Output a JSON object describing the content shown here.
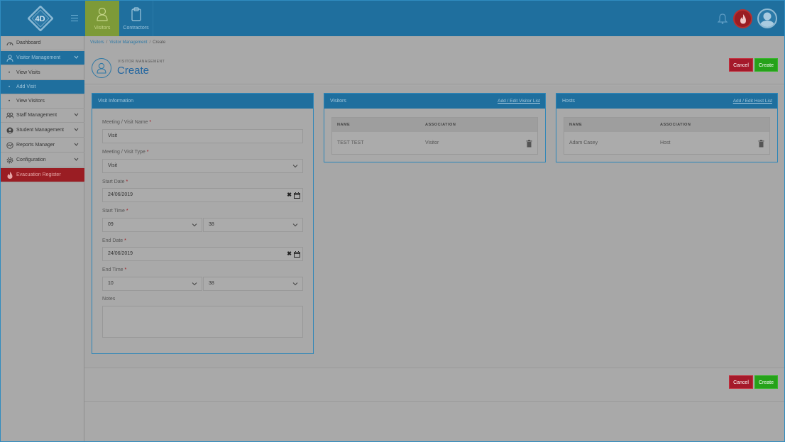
{
  "topbar": {
    "tabs": [
      {
        "label": "Visitors",
        "icon": "person-icon",
        "active": true
      },
      {
        "label": "Contractors",
        "icon": "clipboard-icon",
        "active": false
      }
    ]
  },
  "sidebar": {
    "items": [
      {
        "label": "Dashboard",
        "icon": "dashboard-icon"
      },
      {
        "label": "Visitor Management",
        "icon": "person-icon",
        "active": true
      },
      {
        "label": "View Visits"
      },
      {
        "label": "Add Visit",
        "active": true
      },
      {
        "label": "View Visitors"
      },
      {
        "label": "Staff Management",
        "icon": "staff-icon"
      },
      {
        "label": "Student Management",
        "icon": "student-icon"
      },
      {
        "label": "Reports Manager",
        "icon": "reports-icon"
      },
      {
        "label": "Configuration",
        "icon": "gear-icon"
      },
      {
        "label": "Evacuation Register",
        "icon": "flame-icon"
      }
    ]
  },
  "breadcrumb": [
    "Visitors",
    "Visitor Management",
    "Create"
  ],
  "page": {
    "kicker": "VISITOR MANAGEMENT",
    "title": "Create",
    "cancel_label": "Cancel",
    "create_label": "Create"
  },
  "visit_info": {
    "title": "Visit Information",
    "name_label": "Meeting / Visit Name",
    "name_value": "Visit",
    "type_label": "Meeting / Visit Type",
    "type_value": "Visit",
    "start_date_label": "Start Date",
    "start_date_value": "24/06/2019",
    "start_time_label": "Start Time",
    "start_hour": "09",
    "start_minute": "38",
    "end_date_label": "End Date",
    "end_date_value": "24/06/2019",
    "end_time_label": "End Time",
    "end_hour": "10",
    "end_minute": "38",
    "notes_label": "Notes",
    "required_mark": "*"
  },
  "visitors": {
    "title": "Visitors",
    "action": "Add / Edit Visitor List",
    "columns": [
      "NAME",
      "ASSOCIATION"
    ],
    "rows": [
      {
        "name": "TEST TEST",
        "association": "Visitor"
      }
    ]
  },
  "hosts": {
    "title": "Hosts",
    "action": "Add / Edit Host List",
    "columns": [
      "NAME",
      "ASSOCIATION"
    ],
    "rows": [
      {
        "name": "Adam Casey",
        "association": "Host"
      }
    ]
  },
  "colors": {
    "primary": "#1f6f9e",
    "cancel": "#a5192a",
    "create": "#26a21a",
    "evacuation": "#9a1d23"
  }
}
